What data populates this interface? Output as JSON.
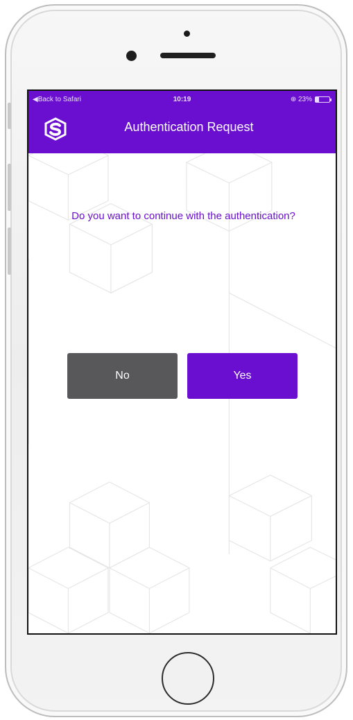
{
  "status_bar": {
    "back_label": "◀Back to Safari",
    "time": "10:19",
    "battery_text": "⊕ 23%",
    "battery_percent": 23
  },
  "nav": {
    "title": "Authentication Request",
    "logo_icon": "shield-s-logo-icon"
  },
  "prompt": {
    "question": "Do you want to continue with the authentication?"
  },
  "actions": {
    "no_label": "No",
    "yes_label": "Yes"
  },
  "colors": {
    "brand_purple": "#6a0fd0",
    "no_button_gray": "#58585a"
  }
}
